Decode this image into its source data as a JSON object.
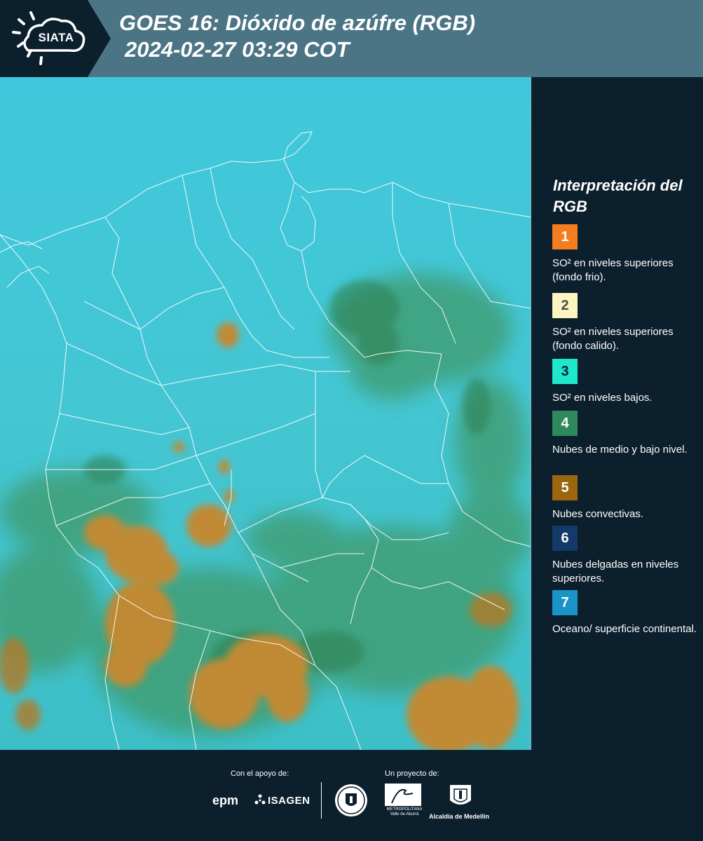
{
  "header": {
    "brand": "SIATA",
    "title_line1": "GOES 16: Dióxido de azúfre (RGB)",
    "title_line2": "2024-02-27 03:29 COT"
  },
  "legend": {
    "title": "Interpretación del RGB",
    "items": [
      {
        "number": "1",
        "color": "#f47d20",
        "label": "SO² en niveles superiores (fondo frio)."
      },
      {
        "number": "2",
        "color": "#fdf5c0",
        "label": "SO² en niveles superiores (fondo calido)."
      },
      {
        "number": "3",
        "color": "#1ee8c9",
        "label": "SO² en niveles bajos."
      },
      {
        "number": "4",
        "color": "#2e8a5e",
        "label": "Nubes de medio y bajo nivel."
      },
      {
        "number": "5",
        "color": "#9c660f",
        "label": "Nubes convectivas."
      },
      {
        "number": "6",
        "color": "#143a6a",
        "label": "Nubes delgadas en niveles superiores."
      },
      {
        "number": "7",
        "color": "#1a93c7",
        "label": "Oceano/ superficie continental."
      }
    ]
  },
  "map": {
    "background_color": "#3bc6d8",
    "border_color": "#ffffff",
    "icons": [
      "map-satellite-image"
    ]
  },
  "footer": {
    "support_label": "Con el apoyo de:",
    "project_label": "Un proyecto de:",
    "partners": [
      "epm",
      "ISAGEN"
    ],
    "area_logo_text": "METROPOLITANA Valle de Aburrá",
    "alcaldia_label": "Alcaldía de Medellín"
  }
}
